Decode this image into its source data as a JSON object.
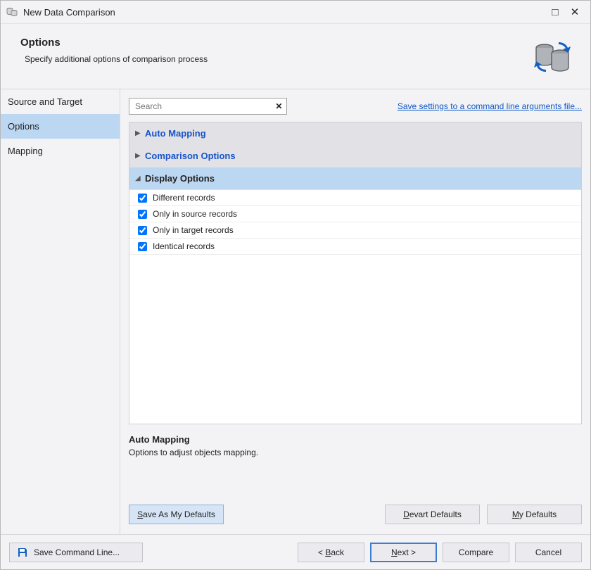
{
  "window_title": "New Data Comparison",
  "header": {
    "title": "Options",
    "subtitle": "Specify additional options of comparison process"
  },
  "sidebar": [
    {
      "label": "Source and Target",
      "selected": false
    },
    {
      "label": "Options",
      "selected": true
    },
    {
      "label": "Mapping",
      "selected": false
    }
  ],
  "search": {
    "placeholder": "Search",
    "clear_icon": "✕"
  },
  "save_settings_link": "Save settings to a command line arguments file...",
  "sections": [
    {
      "label": "Auto Mapping",
      "expanded": false,
      "interactive_title": true
    },
    {
      "label": "Comparison Options",
      "expanded": false,
      "interactive_title": true
    },
    {
      "label": "Display Options",
      "expanded": true,
      "interactive_title": false
    }
  ],
  "display_options": [
    {
      "label": "Different records",
      "checked": true
    },
    {
      "label": "Only in source records",
      "checked": true
    },
    {
      "label": "Only in target records",
      "checked": true
    },
    {
      "label": "Identical records",
      "checked": true
    }
  ],
  "help": {
    "title": "Auto Mapping",
    "text": "Options to adjust objects mapping."
  },
  "main_buttons": {
    "save_defaults": "Save As My Defaults",
    "devart_defaults": "Devart Defaults",
    "my_defaults": "My Defaults"
  },
  "footer": {
    "save_cmd": "Save Command Line...",
    "back": "< Back",
    "next": "Next >",
    "compare": "Compare",
    "cancel": "Cancel"
  }
}
